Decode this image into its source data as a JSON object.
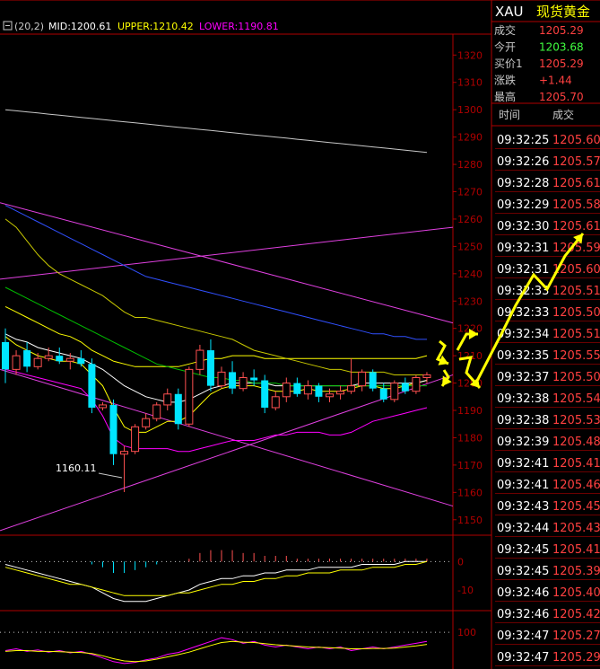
{
  "colors": {
    "background": "#000000",
    "border": "#b00000",
    "up_candle": "#ff5050",
    "down_candle": "#00e5ff",
    "mid_line": "#ffffff",
    "upper_line": "#ffff00",
    "lower_line": "#ff00ff",
    "ma_dark_yellow": "#c8c800",
    "ma_blue": "#3050ff",
    "ma_green": "#00c000",
    "trend_line": "#e040e0",
    "arrow": "#ffff00",
    "label_white": "#ffffff",
    "value_red": "#ff4040",
    "value_green": "#40ff40",
    "label_grey": "#c8c8c8",
    "header_yellow": "#ffff00"
  },
  "indicator": {
    "params": "(20,2)",
    "mid_label": "MID:1200.61",
    "upper_label": "UPPER:1210.42",
    "lower_label": "LOWER:1190.81"
  },
  "low_annotation": "1160.11",
  "quote": {
    "symbol": "XAU",
    "name": "现货黄金",
    "rows": [
      {
        "label": "成交",
        "value": "1205.29",
        "color": "#ff4040"
      },
      {
        "label": "今开",
        "value": "1203.68",
        "color": "#40ff40"
      },
      {
        "label": "买价1",
        "value": "1205.29",
        "color": "#ff4040"
      },
      {
        "label": "涨跌",
        "value": "+1.44",
        "color": "#ff4040"
      },
      {
        "label": "最高",
        "value": "1205.70",
        "color": "#ff4040"
      }
    ]
  },
  "ticks": {
    "headers": {
      "time": "时间",
      "price": "成交"
    },
    "rows": [
      {
        "time": "09:32:25",
        "price": "1205.60"
      },
      {
        "time": "09:32:26",
        "price": "1205.57"
      },
      {
        "time": "09:32:28",
        "price": "1205.61"
      },
      {
        "time": "09:32:29",
        "price": "1205.58"
      },
      {
        "time": "09:32:30",
        "price": "1205.61"
      },
      {
        "time": "09:32:31",
        "price": "1205.59"
      },
      {
        "time": "09:32:31",
        "price": "1205.60"
      },
      {
        "time": "09:32:33",
        "price": "1205.51"
      },
      {
        "time": "09:32:33",
        "price": "1205.50"
      },
      {
        "time": "09:32:34",
        "price": "1205.51"
      },
      {
        "time": "09:32:35",
        "price": "1205.55"
      },
      {
        "time": "09:32:37",
        "price": "1205.50"
      },
      {
        "time": "09:32:38",
        "price": "1205.54"
      },
      {
        "time": "09:32:38",
        "price": "1205.53"
      },
      {
        "time": "09:32:39",
        "price": "1205.48"
      },
      {
        "time": "09:32:41",
        "price": "1205.41"
      },
      {
        "time": "09:32:41",
        "price": "1205.46"
      },
      {
        "time": "09:32:43",
        "price": "1205.45"
      },
      {
        "time": "09:32:44",
        "price": "1205.43"
      },
      {
        "time": "09:32:45",
        "price": "1205.41"
      },
      {
        "time": "09:32:45",
        "price": "1205.39"
      },
      {
        "time": "09:32:46",
        "price": "1205.40"
      },
      {
        "time": "09:32:46",
        "price": "1205.42"
      },
      {
        "time": "09:32:47",
        "price": "1205.27"
      },
      {
        "time": "09:32:47",
        "price": "1205.29"
      }
    ]
  },
  "chart_data": {
    "type": "candlestick",
    "title": "",
    "ylim": [
      1145,
      1327
    ],
    "y_ticks": [
      "1320",
      "1310",
      "1300",
      "1290",
      "1280",
      "1270",
      "1260",
      "1250",
      "1240",
      "1230",
      "1220",
      "1210",
      "1200",
      "1190",
      "1180",
      "1170",
      "1160",
      "1150"
    ],
    "candles": [
      {
        "o": 1215,
        "h": 1220,
        "l": 1200,
        "c": 1205
      },
      {
        "o": 1205,
        "h": 1212,
        "l": 1203,
        "c": 1210
      },
      {
        "o": 1212,
        "h": 1215,
        "l": 1204,
        "c": 1206
      },
      {
        "o": 1206,
        "h": 1211,
        "l": 1205,
        "c": 1209
      },
      {
        "o": 1209,
        "h": 1213,
        "l": 1208,
        "c": 1210
      },
      {
        "o": 1210,
        "h": 1213,
        "l": 1207,
        "c": 1208
      },
      {
        "o": 1208,
        "h": 1211,
        "l": 1205,
        "c": 1209
      },
      {
        "o": 1209,
        "h": 1212,
        "l": 1206,
        "c": 1207
      },
      {
        "o": 1207,
        "h": 1209,
        "l": 1189,
        "c": 1191
      },
      {
        "o": 1191,
        "h": 1193,
        "l": 1190,
        "c": 1192
      },
      {
        "o": 1192,
        "h": 1194,
        "l": 1170,
        "c": 1174
      },
      {
        "o": 1174,
        "h": 1177,
        "l": 1160.11,
        "c": 1175
      },
      {
        "o": 1175,
        "h": 1185,
        "l": 1174,
        "c": 1184
      },
      {
        "o": 1184,
        "h": 1189,
        "l": 1183,
        "c": 1187
      },
      {
        "o": 1187,
        "h": 1193,
        "l": 1186,
        "c": 1192
      },
      {
        "o": 1192,
        "h": 1198,
        "l": 1190,
        "c": 1196
      },
      {
        "o": 1196,
        "h": 1198,
        "l": 1183,
        "c": 1185
      },
      {
        "o": 1185,
        "h": 1206,
        "l": 1184,
        "c": 1205
      },
      {
        "o": 1205,
        "h": 1214,
        "l": 1203,
        "c": 1212
      },
      {
        "o": 1212,
        "h": 1216,
        "l": 1197,
        "c": 1199
      },
      {
        "o": 1199,
        "h": 1206,
        "l": 1198,
        "c": 1204
      },
      {
        "o": 1204,
        "h": 1208,
        "l": 1196,
        "c": 1198
      },
      {
        "o": 1198,
        "h": 1204,
        "l": 1197,
        "c": 1202
      },
      {
        "o": 1202,
        "h": 1205,
        "l": 1199,
        "c": 1201
      },
      {
        "o": 1201,
        "h": 1203,
        "l": 1189,
        "c": 1191
      },
      {
        "o": 1191,
        "h": 1197,
        "l": 1190,
        "c": 1195
      },
      {
        "o": 1195,
        "h": 1202,
        "l": 1193,
        "c": 1200
      },
      {
        "o": 1200,
        "h": 1202,
        "l": 1195,
        "c": 1196
      },
      {
        "o": 1196,
        "h": 1201,
        "l": 1194,
        "c": 1199
      },
      {
        "o": 1199,
        "h": 1200,
        "l": 1193,
        "c": 1195
      },
      {
        "o": 1195,
        "h": 1198,
        "l": 1193,
        "c": 1196
      },
      {
        "o": 1196,
        "h": 1199,
        "l": 1194,
        "c": 1197
      },
      {
        "o": 1197,
        "h": 1209,
        "l": 1196,
        "c": 1199
      },
      {
        "o": 1199,
        "h": 1205,
        "l": 1197,
        "c": 1204
      },
      {
        "o": 1204,
        "h": 1205,
        "l": 1197,
        "c": 1198
      },
      {
        "o": 1198,
        "h": 1200,
        "l": 1193,
        "c": 1194
      },
      {
        "o": 1194,
        "h": 1201,
        "l": 1193,
        "c": 1200
      },
      {
        "o": 1200,
        "h": 1202,
        "l": 1196,
        "c": 1197
      },
      {
        "o": 1197,
        "h": 1203,
        "l": 1196,
        "c": 1202
      },
      {
        "o": 1202,
        "h": 1204,
        "l": 1200,
        "c": 1203
      }
    ],
    "series": [
      {
        "color": "#ffff00",
        "values": [
          1217,
          1214,
          1212,
          1210,
          1209,
          1208,
          1208,
          1207,
          1203,
          1199,
          1191,
          1184,
          1182,
          1182,
          1184,
          1186,
          1186,
          1188,
          1192,
          1196,
          1198,
          1199,
          1199,
          1199,
          1198,
          1197,
          1197,
          1197,
          1198,
          1197,
          1197,
          1197,
          1198,
          1199,
          1199,
          1198,
          1198,
          1199,
          1200,
          1201
        ]
      },
      {
        "color": "#ffffff",
        "values": [
          1218,
          1216,
          1215,
          1213,
          1212,
          1211,
          1210,
          1209,
          1207,
          1205,
          1202,
          1199,
          1197,
          1195,
          1194,
          1193,
          1193,
          1194,
          1196,
          1198,
          1199,
          1200,
          1200,
          1200,
          1200,
          1199,
          1199,
          1199,
          1199,
          1199,
          1199,
          1199,
          1199,
          1200,
          1200,
          1200,
          1200,
          1200,
          1200,
          1201
        ]
      },
      {
        "color": "#ffff00",
        "values": [
          1228,
          1226,
          1224,
          1222,
          1220,
          1218,
          1217,
          1215,
          1212,
          1210,
          1208,
          1207,
          1206,
          1206,
          1206,
          1206,
          1206,
          1207,
          1208,
          1209,
          1209,
          1210,
          1210,
          1210,
          1209,
          1209,
          1209,
          1209,
          1209,
          1209,
          1209,
          1209,
          1209,
          1209,
          1209,
          1209,
          1209,
          1209,
          1209,
          1210
        ]
      },
      {
        "color": "#ff00ff",
        "values": [
          1205,
          1204,
          1203,
          1202,
          1201,
          1200,
          1199,
          1198,
          1194,
          1188,
          1180,
          1177,
          1176,
          1176,
          1176,
          1176,
          1175,
          1175,
          1176,
          1177,
          1178,
          1179,
          1179,
          1179,
          1180,
          1181,
          1181,
          1182,
          1182,
          1182,
          1181,
          1181,
          1182,
          1184,
          1186,
          1187,
          1188,
          1189,
          1190,
          1191
        ]
      },
      {
        "color": "#c8c800",
        "values": [
          1260,
          1257,
          1252,
          1247,
          1243,
          1240,
          1238,
          1236,
          1234,
          1232,
          1229,
          1226,
          1224,
          1224,
          1223,
          1222,
          1221,
          1220,
          1219,
          1218,
          1217,
          1216,
          1214,
          1212,
          1211,
          1210,
          1209,
          1208,
          1207,
          1206,
          1205,
          1205,
          1204,
          1204,
          1204,
          1204,
          1203,
          1203,
          1203,
          1203
        ]
      },
      {
        "color": "#3050ff",
        "values": [
          1265,
          1263,
          1261,
          1259,
          1257,
          1255,
          1253,
          1251,
          1249,
          1247,
          1245,
          1243,
          1241,
          1239,
          1238,
          1237,
          1236,
          1235,
          1234,
          1233,
          1232,
          1231,
          1230,
          1229,
          1228,
          1227,
          1226,
          1225,
          1224,
          1223,
          1222,
          1221,
          1220,
          1219,
          1218,
          1218,
          1217,
          1217,
          1216,
          1216
        ]
      },
      {
        "color": "#00c000",
        "values": [
          1235,
          1233,
          1231,
          1229,
          1227,
          1225,
          1223,
          1221,
          1219,
          1217,
          1215,
          1213,
          1211,
          1209,
          1207,
          1206,
          1205,
          1204,
          1203,
          1202,
          1202,
          1201,
          1201,
          1200,
          1200,
          1200,
          1199,
          1199,
          1199,
          1199,
          1199,
          1199,
          1199,
          1199,
          1199,
          1199,
          1199,
          1199,
          1199,
          1199
        ]
      },
      {
        "color": "#c8c8c8",
        "values": [
          1300,
          1299.6,
          1299.2,
          1298.8,
          1298.4,
          1298,
          1297.6,
          1297.2,
          1296.8,
          1296.4,
          1296,
          1295.6,
          1295.2,
          1294.8,
          1294.4,
          1294,
          1293.6,
          1293.2,
          1292.8,
          1292.4,
          1292,
          1291.6,
          1291.2,
          1290.8,
          1290.4,
          1290,
          1289.6,
          1289.2,
          1288.8,
          1288.4,
          1288,
          1287.6,
          1287.2,
          1286.8,
          1286.4,
          1286,
          1285.6,
          1285.2,
          1284.8,
          1284.4
        ]
      }
    ],
    "macd": {
      "y_ticks": [
        "0",
        "-10"
      ],
      "bars": [
        0,
        0,
        0,
        0,
        0,
        0,
        0,
        0,
        -1,
        -2,
        -4,
        -4,
        -3,
        -2,
        -1,
        0,
        0,
        1,
        3,
        4,
        4,
        4,
        3,
        3,
        2,
        2,
        2,
        1,
        1,
        1,
        1,
        1,
        1,
        1,
        1,
        1,
        1,
        1,
        1,
        1
      ],
      "dif": [
        -1,
        -2,
        -3,
        -4,
        -5,
        -6,
        -7,
        -8,
        -9,
        -11,
        -13,
        -14,
        -14,
        -14,
        -13,
        -12,
        -11,
        -10,
        -8,
        -7,
        -6,
        -6,
        -5,
        -5,
        -4,
        -4,
        -3,
        -3,
        -3,
        -2,
        -2,
        -2,
        -2,
        -1,
        -1,
        -1,
        -1,
        0,
        0,
        0
      ],
      "dea": [
        -2,
        -3,
        -4,
        -5,
        -6,
        -7,
        -8,
        -8,
        -9,
        -10,
        -11,
        -12,
        -12,
        -12,
        -12,
        -12,
        -11,
        -11,
        -10,
        -9,
        -8,
        -8,
        -7,
        -7,
        -6,
        -6,
        -5,
        -5,
        -4,
        -4,
        -4,
        -3,
        -3,
        -3,
        -2,
        -2,
        -2,
        -1,
        -1,
        0
      ]
    },
    "osc": {
      "y_ticks": [
        "100"
      ],
      "line1": [
        50,
        55,
        48,
        52,
        46,
        50,
        44,
        48,
        40,
        30,
        20,
        15,
        18,
        25,
        30,
        40,
        45,
        55,
        65,
        75,
        85,
        80,
        70,
        75,
        65,
        60,
        65,
        60,
        55,
        60,
        55,
        60,
        50,
        55,
        60,
        55,
        60,
        65,
        70,
        75
      ],
      "line2": [
        48,
        50,
        50,
        48,
        48,
        47,
        46,
        45,
        42,
        36,
        28,
        22,
        20,
        22,
        27,
        33,
        39,
        46,
        55,
        64,
        72,
        75,
        73,
        72,
        69,
        66,
        64,
        62,
        60,
        59,
        58,
        57,
        55,
        55,
        56,
        56,
        57,
        60,
        63,
        67
      ]
    }
  }
}
